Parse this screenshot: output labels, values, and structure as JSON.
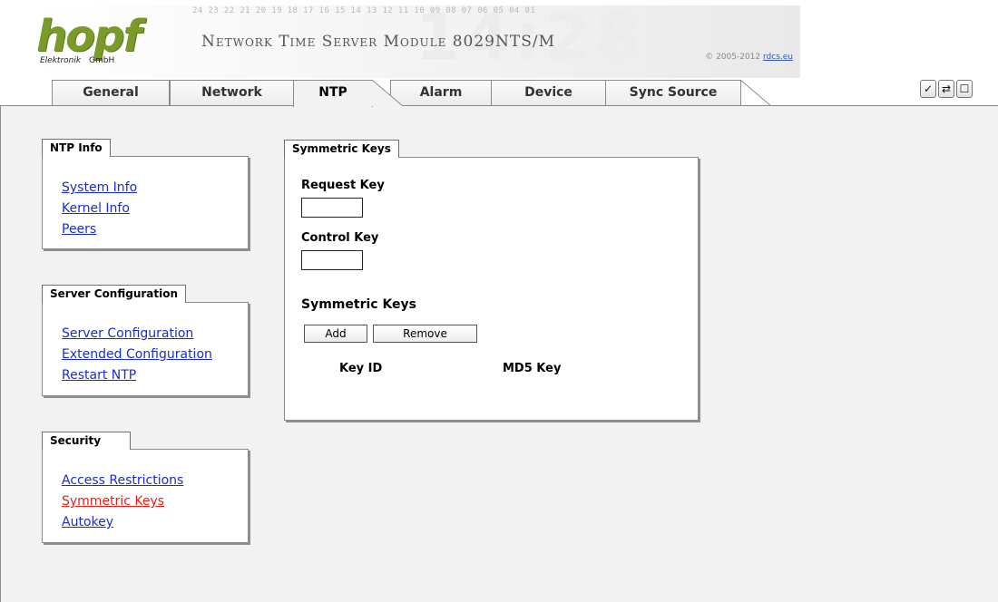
{
  "header": {
    "logo_word": "hopf",
    "logo_sub_left": "Elektronik",
    "logo_sub_right": "GmbH",
    "scale_numbers": "24 23 22 21 20 19 18 17 16 15 14 13 12 11 10 09 08 07 06 05 04 01",
    "background_digits": "14:28",
    "title": "Network Time Server Module 8029NTS/M",
    "copyright_prefix": "© 2005-2012",
    "copyright_link": "rdcs.eu"
  },
  "tabs": [
    {
      "label": "General",
      "active": false
    },
    {
      "label": "Network",
      "active": false
    },
    {
      "label": "NTP",
      "active": true
    },
    {
      "label": "Alarm",
      "active": false
    },
    {
      "label": "Device",
      "active": false
    },
    {
      "label": "Sync Source",
      "active": false
    }
  ],
  "toolbar": {
    "apply_icon": "checkmark-icon",
    "reload_icon": "refresh-icon",
    "save_icon": "save-icon"
  },
  "sidebar": {
    "ntp_info": {
      "title": "NTP Info",
      "links": [
        "System Info",
        "Kernel Info",
        "Peers"
      ]
    },
    "server_configuration": {
      "title": "Server Configuration",
      "links": [
        "Server Configuration",
        "Extended Configuration",
        "Restart NTP"
      ]
    },
    "security": {
      "title": "Security",
      "links": [
        "Access Restrictions",
        "Symmetric Keys",
        "Autokey"
      ],
      "active_link": "Symmetric Keys"
    }
  },
  "main": {
    "panel_title": "Symmetric Keys",
    "request_key_label": "Request Key",
    "request_key_value": "",
    "control_key_label": "Control Key",
    "control_key_value": "",
    "symmetric_keys_heading": "Symmetric Keys",
    "add_button": "Add",
    "remove_button": "Remove",
    "columns": [
      "Key ID",
      "MD5 Key"
    ]
  },
  "colors": {
    "link": "#1a2fc4",
    "active_link": "#e2231a",
    "logo": "#7a9a2a",
    "content_bg": "#f2f2f2"
  }
}
